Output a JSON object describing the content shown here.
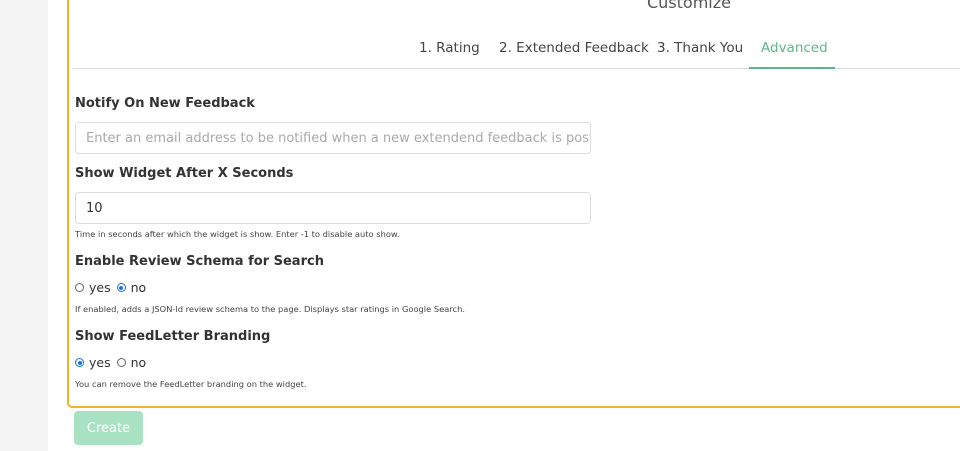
{
  "title": "Customize",
  "tabs": [
    {
      "label": "1. Rating"
    },
    {
      "label": "2. Extended Feedback"
    },
    {
      "label": "3. Thank You"
    },
    {
      "label": "Advanced"
    }
  ],
  "notify": {
    "label": "Notify On New Feedback",
    "placeholder": "Enter an email address to be notified when a new extendend feedback is posted",
    "value": ""
  },
  "show_after": {
    "label": "Show Widget After X Seconds",
    "value": "10",
    "help": "Time in seconds after which the widget is show. Enter -1 to disable auto show."
  },
  "review_schema": {
    "label": "Enable Review Schema for Search",
    "yes_label": "yes",
    "no_label": "no",
    "selected": "no",
    "help": "If enabled, adds a JSON-ld review schema to the page. Displays star ratings in Google Search."
  },
  "branding": {
    "label": "Show FeedLetter Branding",
    "yes_label": "yes",
    "no_label": "no",
    "selected": "yes",
    "help": "You can remove the FeedLetter branding on the widget."
  },
  "create_label": "Create",
  "colors": {
    "accent": "#5cb88a",
    "panel_border": "#f0b429",
    "button_bg": "#a9e1c3"
  }
}
